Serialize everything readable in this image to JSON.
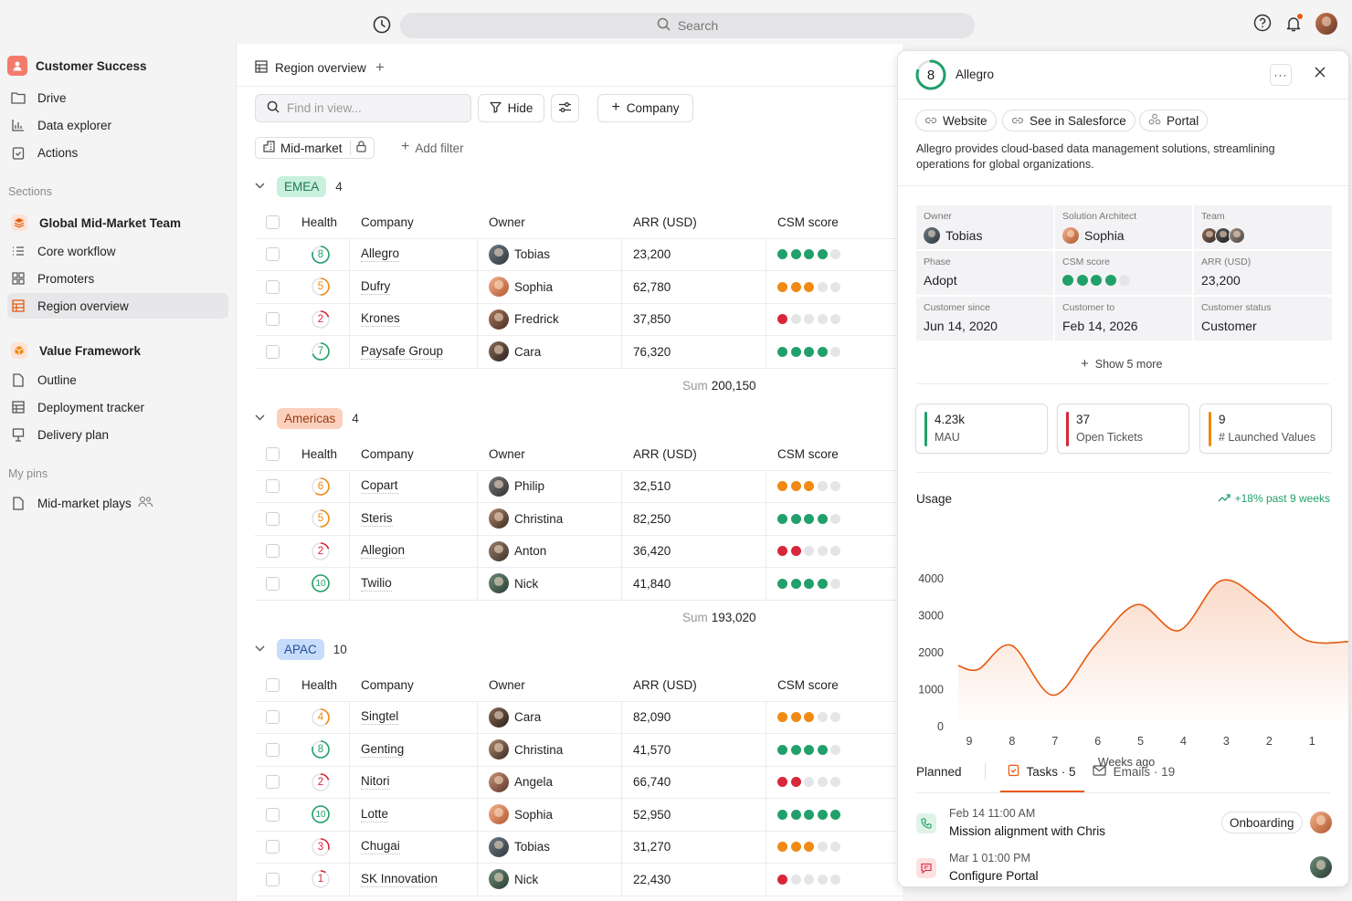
{
  "search": {
    "label": "Search"
  },
  "colors": {
    "green": "#22a06b",
    "orange": "#f08a14",
    "red": "#d8263a",
    "empty": "#e5e5e8",
    "accent": "#e8590c"
  },
  "sidebar": {
    "workspace": "Customer Success",
    "top": [
      {
        "label": "Drive",
        "icon": "folder-icon"
      },
      {
        "label": "Data explorer",
        "icon": "bar-chart-icon"
      },
      {
        "label": "Actions",
        "icon": "clipboard-icon"
      }
    ],
    "sections_label": "Sections",
    "team": "Global Mid-Market Team",
    "team_items": [
      {
        "label": "Core workflow",
        "icon": "list-icon"
      },
      {
        "label": "Promoters",
        "icon": "grid-icon"
      },
      {
        "label": "Region overview",
        "icon": "table-icon"
      }
    ],
    "value": "Value Framework",
    "value_items": [
      {
        "label": "Outline",
        "icon": "document-icon"
      },
      {
        "label": "Deployment tracker",
        "icon": "table-icon"
      },
      {
        "label": "Delivery plan",
        "icon": "presentation-icon"
      }
    ],
    "pins_label": "My pins",
    "pins": [
      {
        "label": "Mid-market plays",
        "icon": "document-icon"
      }
    ]
  },
  "view": {
    "title": "Region overview",
    "find_placeholder": "Find in view...",
    "hide_label": "Hide",
    "company_label": "Company",
    "filter_chip": "Mid-market",
    "add_filter": "Add filter",
    "columns": [
      "Health",
      "Company",
      "Owner",
      "ARR (USD)",
      "CSM score"
    ],
    "sum_label": "Sum"
  },
  "groups": [
    {
      "name": "EMEA",
      "count": "4",
      "sum": "200,150",
      "color": "green",
      "rows": [
        {
          "health": 8,
          "company": "Allegro",
          "owner": "Tobias",
          "arr": "23,200",
          "score": 4,
          "score_color": "green"
        },
        {
          "health": 5,
          "company": "Dufry",
          "owner": "Sophia",
          "arr": "62,780",
          "score": 3,
          "score_color": "orange"
        },
        {
          "health": 2,
          "company": "Krones",
          "owner": "Fredrick",
          "arr": "37,850",
          "score": 1,
          "score_color": "red"
        },
        {
          "health": 7,
          "company": "Paysafe Group",
          "owner": "Cara",
          "arr": "76,320",
          "score": 4,
          "score_color": "green"
        }
      ]
    },
    {
      "name": "Americas",
      "count": "4",
      "sum": "193,020",
      "color": "orange",
      "rows": [
        {
          "health": 6,
          "company": "Copart",
          "owner": "Philip",
          "arr": "32,510",
          "score": 3,
          "score_color": "orange"
        },
        {
          "health": 5,
          "company": "Steris",
          "owner": "Christina",
          "arr": "82,250",
          "score": 4,
          "score_color": "green"
        },
        {
          "health": 2,
          "company": "Allegion",
          "owner": "Anton",
          "arr": "36,420",
          "score": 2,
          "score_color": "red"
        },
        {
          "health": 10,
          "company": "Twilio",
          "owner": "Nick",
          "arr": "41,840",
          "score": 4,
          "score_color": "green"
        }
      ]
    },
    {
      "name": "APAC",
      "count": "10",
      "sum": "",
      "color": "blue",
      "rows": [
        {
          "health": 4,
          "company": "Singtel",
          "owner": "Cara",
          "arr": "82,090",
          "score": 3,
          "score_color": "orange"
        },
        {
          "health": 8,
          "company": "Genting",
          "owner": "Christina",
          "arr": "41,570",
          "score": 4,
          "score_color": "green"
        },
        {
          "health": 2,
          "company": "Nitori",
          "owner": "Angela",
          "arr": "66,740",
          "score": 2,
          "score_color": "red"
        },
        {
          "health": 10,
          "company": "Lotte",
          "owner": "Sophia",
          "arr": "52,950",
          "score": 5,
          "score_color": "green"
        },
        {
          "health": 3,
          "company": "Chugai",
          "owner": "Tobias",
          "arr": "31,270",
          "score": 3,
          "score_color": "orange"
        },
        {
          "health": 1,
          "company": "SK Innovation",
          "owner": "Nick",
          "arr": "22,430",
          "score": 1,
          "score_color": "red"
        }
      ]
    }
  ],
  "panel": {
    "score": "8",
    "name": "Allegro",
    "links": [
      "Website",
      "See in Salesforce",
      "Portal"
    ],
    "description": "Allegro provides cloud-based data management solutions, streamlining operations for global organizations.",
    "fields": [
      {
        "label": "Owner",
        "value": "Tobias"
      },
      {
        "label": "Solution Architect",
        "value": "Sophia"
      },
      {
        "label": "Team",
        "value": ""
      },
      {
        "label": "Phase",
        "value": "Adopt"
      },
      {
        "label": "CSM score",
        "value": ""
      },
      {
        "label": "ARR (USD)",
        "value": "23,200"
      },
      {
        "label": "Customer since",
        "value": "Jun 14, 2020"
      },
      {
        "label": "Customer to",
        "value": "Feb 14, 2026"
      },
      {
        "label": "Customer status",
        "value": "Customer"
      }
    ],
    "csm_score": 4,
    "show_more": "Show 5 more",
    "kpis": [
      {
        "value": "4.23k",
        "label": "MAU",
        "color": "green"
      },
      {
        "value": "37",
        "label": "Open Tickets",
        "color": "red"
      },
      {
        "value": "9",
        "label": "# Launched Values",
        "color": "orange"
      }
    ],
    "usage_title": "Usage",
    "usage_trend": "+18% past 9 weeks",
    "tabs": {
      "planned": "Planned",
      "tasks": "Tasks · 5",
      "emails": "Emails · 19"
    },
    "tasks": [
      {
        "date": "Feb 14 11:00 AM",
        "title": "Mission alignment with Chris",
        "badge": "Onboarding"
      },
      {
        "date": "Mar 1 01:00 PM",
        "title": "Configure Portal",
        "badge": ""
      }
    ]
  },
  "chart_data": {
    "type": "area",
    "title": "Usage",
    "xlabel": "Weeks ago",
    "ylabel": "",
    "x": [
      9,
      8,
      7,
      6,
      5,
      4,
      3,
      2,
      1
    ],
    "categories": [
      "9",
      "8",
      "7",
      "6",
      "5",
      "4",
      "3",
      "2",
      "1"
    ],
    "y_ticks": [
      0,
      1000,
      2000,
      3000,
      4000
    ],
    "ylim": [
      0,
      4000
    ],
    "series": [
      {
        "values": [
          1550,
          2200,
          850,
          2200,
          3300,
          2600,
          3950,
          3350,
          2350
        ]
      }
    ],
    "grid": false,
    "color": "#e8590c"
  }
}
